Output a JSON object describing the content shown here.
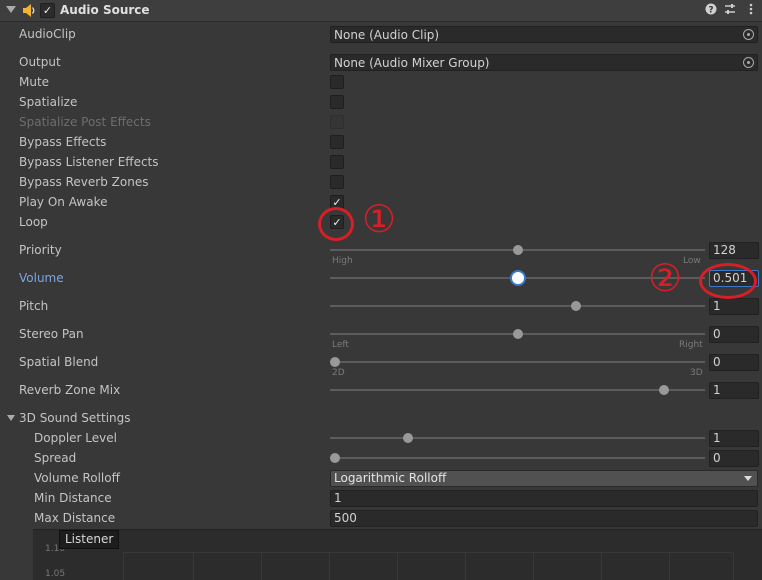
{
  "component": {
    "title": "Audio Source",
    "enabled_mark": "✓",
    "icons": [
      "speaker-icon",
      "help-icon",
      "preset-icon",
      "kebab-menu-icon"
    ]
  },
  "fields": {
    "audio_clip": {
      "label": "AudioClip",
      "value": "None (Audio Clip)"
    },
    "output": {
      "label": "Output",
      "value": "None (Audio Mixer Group)"
    },
    "mute": {
      "label": "Mute",
      "checked": false
    },
    "spatialize": {
      "label": "Spatialize",
      "checked": false
    },
    "spatialize_post_effects": {
      "label": "Spatialize Post Effects",
      "checked": false,
      "disabled": true
    },
    "bypass_effects": {
      "label": "Bypass Effects",
      "checked": false
    },
    "bypass_listener_effects": {
      "label": "Bypass Listener Effects",
      "checked": false
    },
    "bypass_reverb_zones": {
      "label": "Bypass Reverb Zones",
      "checked": false
    },
    "play_on_awake": {
      "label": "Play On Awake",
      "checked": true,
      "mark": "✓"
    },
    "loop": {
      "label": "Loop",
      "checked": true,
      "mark": "✓"
    }
  },
  "sliders": {
    "priority": {
      "label": "Priority",
      "value": "128",
      "fraction": 0.5,
      "min_label": "High",
      "max_label": "Low"
    },
    "volume": {
      "label": "Volume",
      "value": "0.501",
      "fraction": 0.501
    },
    "pitch": {
      "label": "Pitch",
      "value": "1",
      "fraction": 0.66
    },
    "stereo_pan": {
      "label": "Stereo Pan",
      "value": "0",
      "fraction": 0.5,
      "min_label": "Left",
      "max_label": "Right"
    },
    "spatial_blend": {
      "label": "Spatial Blend",
      "value": "0",
      "fraction": 0.0,
      "min_label": "2D",
      "max_label": "3D"
    },
    "reverb_zone_mix": {
      "label": "Reverb Zone Mix",
      "value": "1",
      "fraction": 0.9
    }
  },
  "sound_3d": {
    "label": "3D Sound Settings",
    "doppler_level": {
      "label": "Doppler Level",
      "value": "1",
      "fraction": 0.2
    },
    "spread": {
      "label": "Spread",
      "value": "0",
      "fraction": 0.0
    },
    "volume_rolloff": {
      "label": "Volume Rolloff",
      "value": "Logarithmic Rolloff"
    },
    "min_distance": {
      "label": "Min Distance",
      "value": "1"
    },
    "max_distance": {
      "label": "Max Distance",
      "value": "500"
    }
  },
  "curve_preview": {
    "tooltip": "Listener",
    "y_ticks": [
      "1.10",
      "1.05"
    ]
  },
  "annotations": {
    "loop_marker": "①",
    "volume_marker": "②",
    "color": "#d61f26"
  }
}
